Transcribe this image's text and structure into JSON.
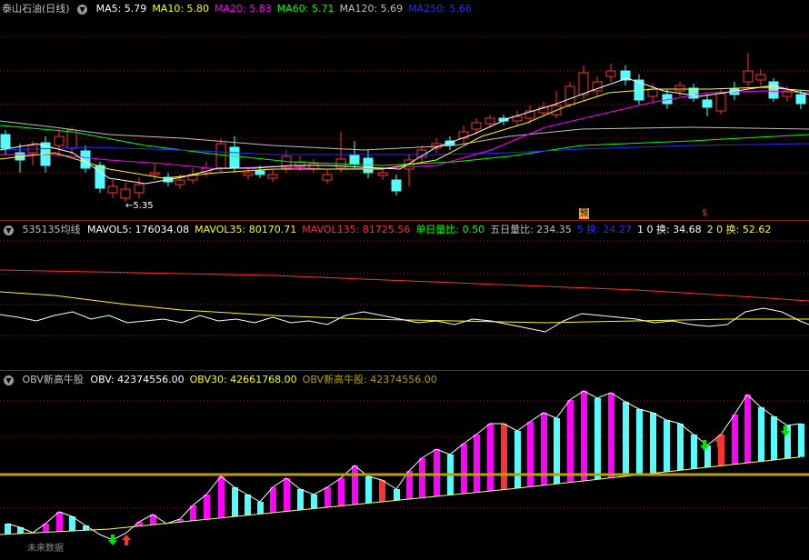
{
  "panel1": {
    "title": "泰山石油(日线)",
    "indicators": [
      {
        "label": "MA5: 5.79",
        "color": "#ffffff"
      },
      {
        "label": "MA10: 5.80",
        "color": "#ffff00"
      },
      {
        "label": "MA20: 5.83",
        "color": "#ff00ff"
      },
      {
        "label": "MA60: 5.71",
        "color": "#00ff00"
      },
      {
        "label": "MA120: 5.69",
        "color": "#c0c0c0"
      },
      {
        "label": "MA250: 5.66",
        "color": "#2a2aff"
      }
    ],
    "low_label": "5.35",
    "marker_yu": "预",
    "marker_s": "$"
  },
  "panel2": {
    "title": "535135均线",
    "indicators": [
      {
        "label": "MAVOL5: 176034.08",
        "color": "#ffffff"
      },
      {
        "label": "MAVOL35: 80170.71",
        "color": "#ffff00"
      },
      {
        "label": "MAVOL135: 81725.56",
        "color": "#ff3030"
      },
      {
        "label": "单日量比: 0.50",
        "color": "#00ff00"
      },
      {
        "label": "五日量比: 234.35",
        "color": "#c0c0c0"
      },
      {
        "label": "5 换: 24.27",
        "color": "#2a2aff"
      },
      {
        "label": "1 0 换: 34.68",
        "color": "#ffffff"
      },
      {
        "label": "2 0 换: 52.62",
        "color": "#ffff00"
      }
    ]
  },
  "panel3": {
    "title": "OBV新高牛股",
    "indicators": [
      {
        "label": "OBV: 42374556.00",
        "color": "#ffffff"
      },
      {
        "label": "OBV30: 42661768.00",
        "color": "#ffff00"
      },
      {
        "label": "OBV新高牛股: 42374556.00",
        "color": "#b8a000"
      }
    ],
    "footer_text": "未来数据"
  },
  "colors": {
    "up": "#ff3232",
    "down": "#54fcfc",
    "magenta": "#ff00ff",
    "grid": "#8b1a1a"
  },
  "icons": {
    "toggle": "chevron-down-icon"
  }
}
